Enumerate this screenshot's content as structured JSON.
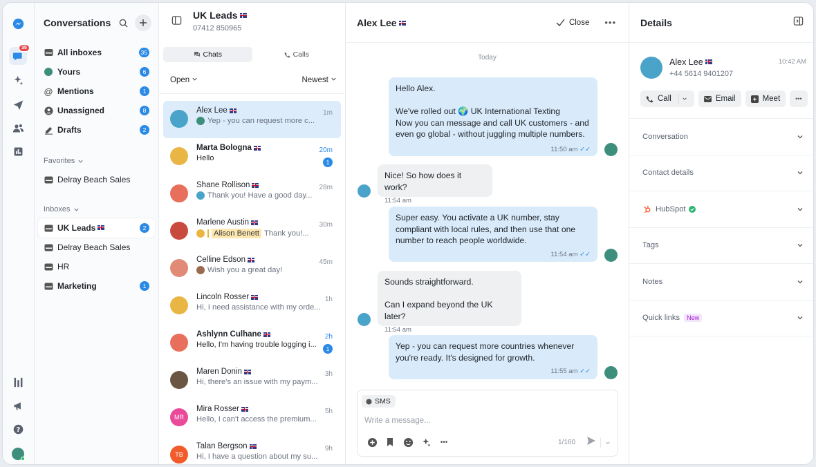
{
  "rail": {
    "inbox_badge": "35"
  },
  "sidebar": {
    "title": "Conversations",
    "items": [
      {
        "label": "All inboxes",
        "count": "35",
        "icon": "inbox-icon"
      },
      {
        "label": "Yours",
        "count": "6",
        "icon": "avatar-icon"
      },
      {
        "label": "Mentions",
        "count": "1",
        "icon": "at-icon"
      },
      {
        "label": "Unassigned",
        "count": "8",
        "icon": "user-circle-icon"
      },
      {
        "label": "Drafts",
        "count": "2",
        "icon": "pen-icon"
      }
    ],
    "favorites_label": "Favorites",
    "favorites": [
      {
        "label": "Delray Beach Sales"
      }
    ],
    "inboxes_label": "Inboxes",
    "inboxes": [
      {
        "label": "UK Leads",
        "count": "2"
      },
      {
        "label": "Delray Beach Sales",
        "count": ""
      },
      {
        "label": "HR",
        "count": ""
      },
      {
        "label": "Marketing",
        "count": "1"
      }
    ]
  },
  "list": {
    "title": "UK Leads",
    "phone": "07412 850965",
    "tab_chats": "Chats",
    "tab_calls": "Calls",
    "filter_status": "Open",
    "filter_sort": "Newest",
    "conversations": [
      {
        "name": "Alex Lee",
        "time": "1m",
        "preview": "Yep - you can request more c...",
        "unread": "",
        "color": "#4aa3c8"
      },
      {
        "name": "Marta Bologna",
        "time": "20m",
        "preview": "Hello",
        "unread": "1",
        "color": "#e9b543"
      },
      {
        "name": "Shane Rollison",
        "time": "28m",
        "preview": "Thank you! Have a good day...",
        "unread": "",
        "color": "#e76f5b"
      },
      {
        "name": "Marlene Austin",
        "time": "30m",
        "preview": "Thank you!...",
        "tag": "Alison Benett",
        "unread": "",
        "color": "#c94a3f"
      },
      {
        "name": "Celline Edson",
        "time": "45m",
        "preview": "Wish you a great day!",
        "unread": "",
        "color": "#e08a77"
      },
      {
        "name": "Lincoln Rosser",
        "time": "1h",
        "preview": "Hi, I need assistance with my orde...",
        "unread": "",
        "color": "#e9b543"
      },
      {
        "name": "Ashlynn Culhane",
        "time": "2h",
        "preview": "Hello, I'm having trouble logging i...",
        "unread": "1",
        "color": "#e76f5b"
      },
      {
        "name": "Maren Donin",
        "time": "3h",
        "preview": "Hi, there's an issue with my paym...",
        "unread": "",
        "color": "#6b5644"
      },
      {
        "name": "Mira Rosser",
        "time": "5h",
        "preview": "Hello, I can't access the premium...",
        "unread": "",
        "initials": "MR",
        "color": "#ea4a9a"
      },
      {
        "name": "Talan Bergson",
        "time": "9h",
        "preview": "Hi, I have a question about my su...",
        "unread": "",
        "initials": "TB",
        "color": "#f25c2a"
      }
    ]
  },
  "chat": {
    "name": "Alex Lee",
    "close_label": "Close",
    "day": "Today",
    "messages": [
      {
        "dir": "out",
        "lines": [
          "Hello Alex.",
          "",
          "We've rolled out 🌍 UK International Texting",
          "Now you can message and call UK customers - and",
          "even go global - without juggling multiple numbers."
        ],
        "time": "11:50 am"
      },
      {
        "dir": "in",
        "lines": [
          "Nice! So how does it work?"
        ],
        "time": "11:54 am"
      },
      {
        "dir": "out",
        "lines": [
          "Super easy. You activate a UK number, stay",
          "compliant with local rules, and then use that one",
          "number to reach people worldwide."
        ],
        "time": "11:54 am"
      },
      {
        "dir": "in",
        "lines": [
          "Sounds straightforward.",
          "",
          "Can I expand beyond the UK later?"
        ],
        "time": "11:54 am"
      },
      {
        "dir": "out",
        "lines": [
          "Yep - you can request more countries whenever",
          "you're ready. It's designed for growth."
        ],
        "time": "11:55 am"
      }
    ],
    "composer": {
      "channel": "SMS",
      "placeholder": "Write a message...",
      "counter": "1/160"
    }
  },
  "details": {
    "title": "Details",
    "contact": {
      "name": "Alex Lee",
      "phone": "+44 5614 9401207",
      "time": "10:42 AM"
    },
    "actions": {
      "call": "Call",
      "email": "Email",
      "meet": "Meet"
    },
    "sections": [
      {
        "label": "Conversation"
      },
      {
        "label": "Contact details"
      },
      {
        "label": "HubSpot"
      },
      {
        "label": "Tags"
      },
      {
        "label": "Notes"
      },
      {
        "label": "Quick links",
        "badge": "New"
      }
    ]
  }
}
